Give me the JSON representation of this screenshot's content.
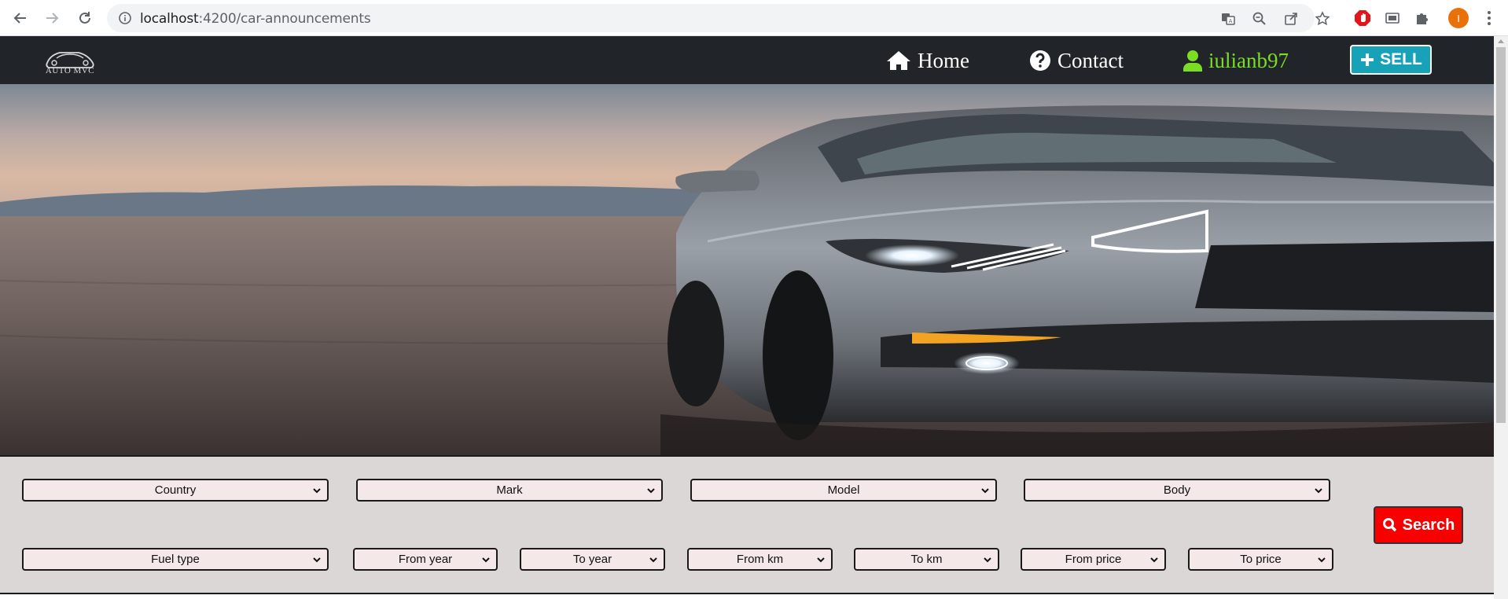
{
  "browser": {
    "url_host": "localhost",
    "url_path": ":4200/car-announcements",
    "profile_initial": "I"
  },
  "navbar": {
    "logo_text": "AUTO MVC",
    "home_label": "Home",
    "contact_label": "Contact",
    "user_label": "iulianb97",
    "sell_label": "SELL"
  },
  "filters": {
    "country": "Country",
    "mark": "Mark",
    "model": "Model",
    "body": "Body",
    "fuel_type": "Fuel type",
    "from_year": "From year",
    "to_year": "To year",
    "from_km": "From km",
    "to_km": "To km",
    "from_price": "From price",
    "to_price": "To price",
    "search_label": "Search"
  },
  "colors": {
    "navbar_bg": "#212529",
    "user_green": "#7bdd24",
    "sell_teal": "#17a2b8",
    "search_red": "#f80000",
    "filter_bg": "#dcd7d7",
    "select_bg": "#f4e8e8"
  },
  "icons": [
    "back-icon",
    "forward-icon",
    "reload-icon",
    "info-icon",
    "translate-icon",
    "zoom-icon",
    "share-icon",
    "star-icon",
    "adblock-icon",
    "cast-icon",
    "puzzle-icon",
    "home-icon",
    "question-icon",
    "user-icon",
    "plus-icon",
    "search-icon",
    "chevron-down-icon"
  ]
}
